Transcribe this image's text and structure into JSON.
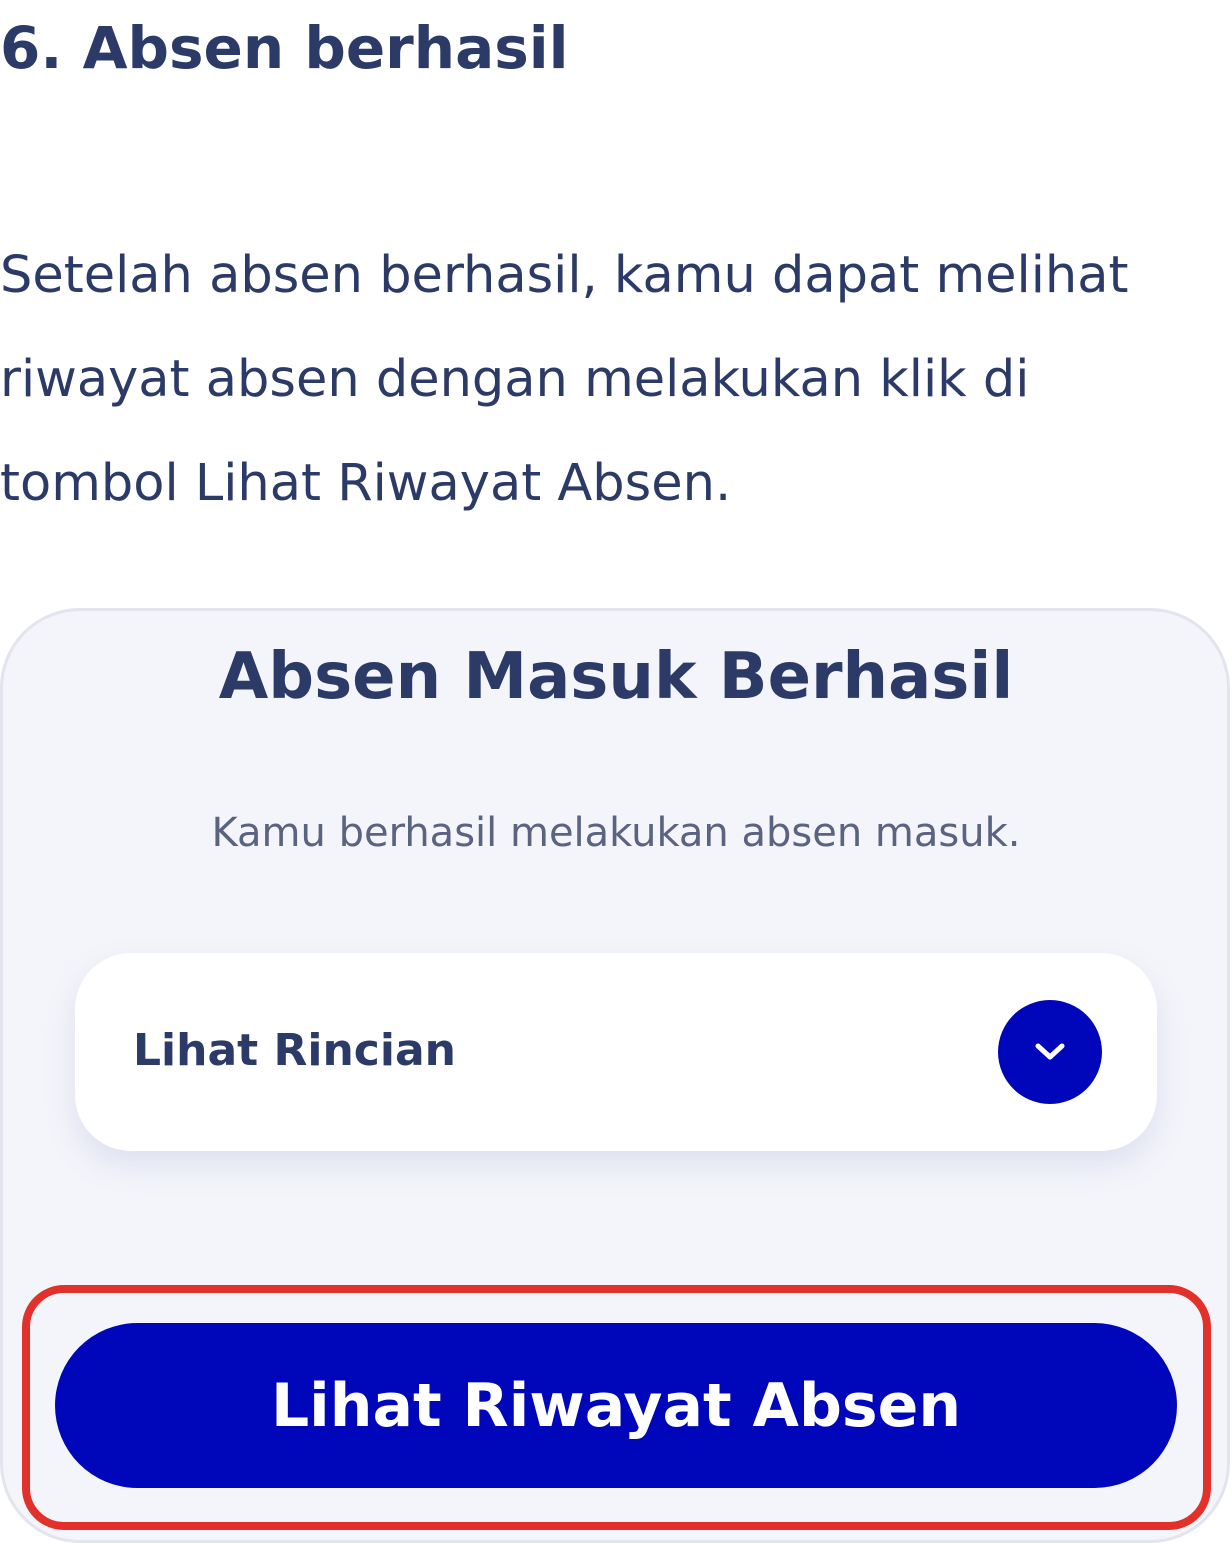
{
  "article": {
    "step_heading": "6. Absen berhasil",
    "description_lines": [
      "Setelah absen berhasil, kamu dapat melihat",
      "riwayat absen dengan melakukan klik di",
      "tombol Lihat Riwayat Absen."
    ]
  },
  "screen": {
    "title": "Absen Masuk Berhasil",
    "subtitle": "Kamu berhasil melakukan absen masuk.",
    "details": {
      "label": "Lihat Rincian",
      "toggle_icon": "chevron-down-icon"
    },
    "history_button_label": "Lihat Riwayat Absen"
  },
  "colors": {
    "text_primary": "#2b3a67",
    "text_secondary": "#5a6380",
    "brand_blue": "#0006ba",
    "card_background": "#f4f5fa",
    "highlight_red": "#e2302a"
  }
}
